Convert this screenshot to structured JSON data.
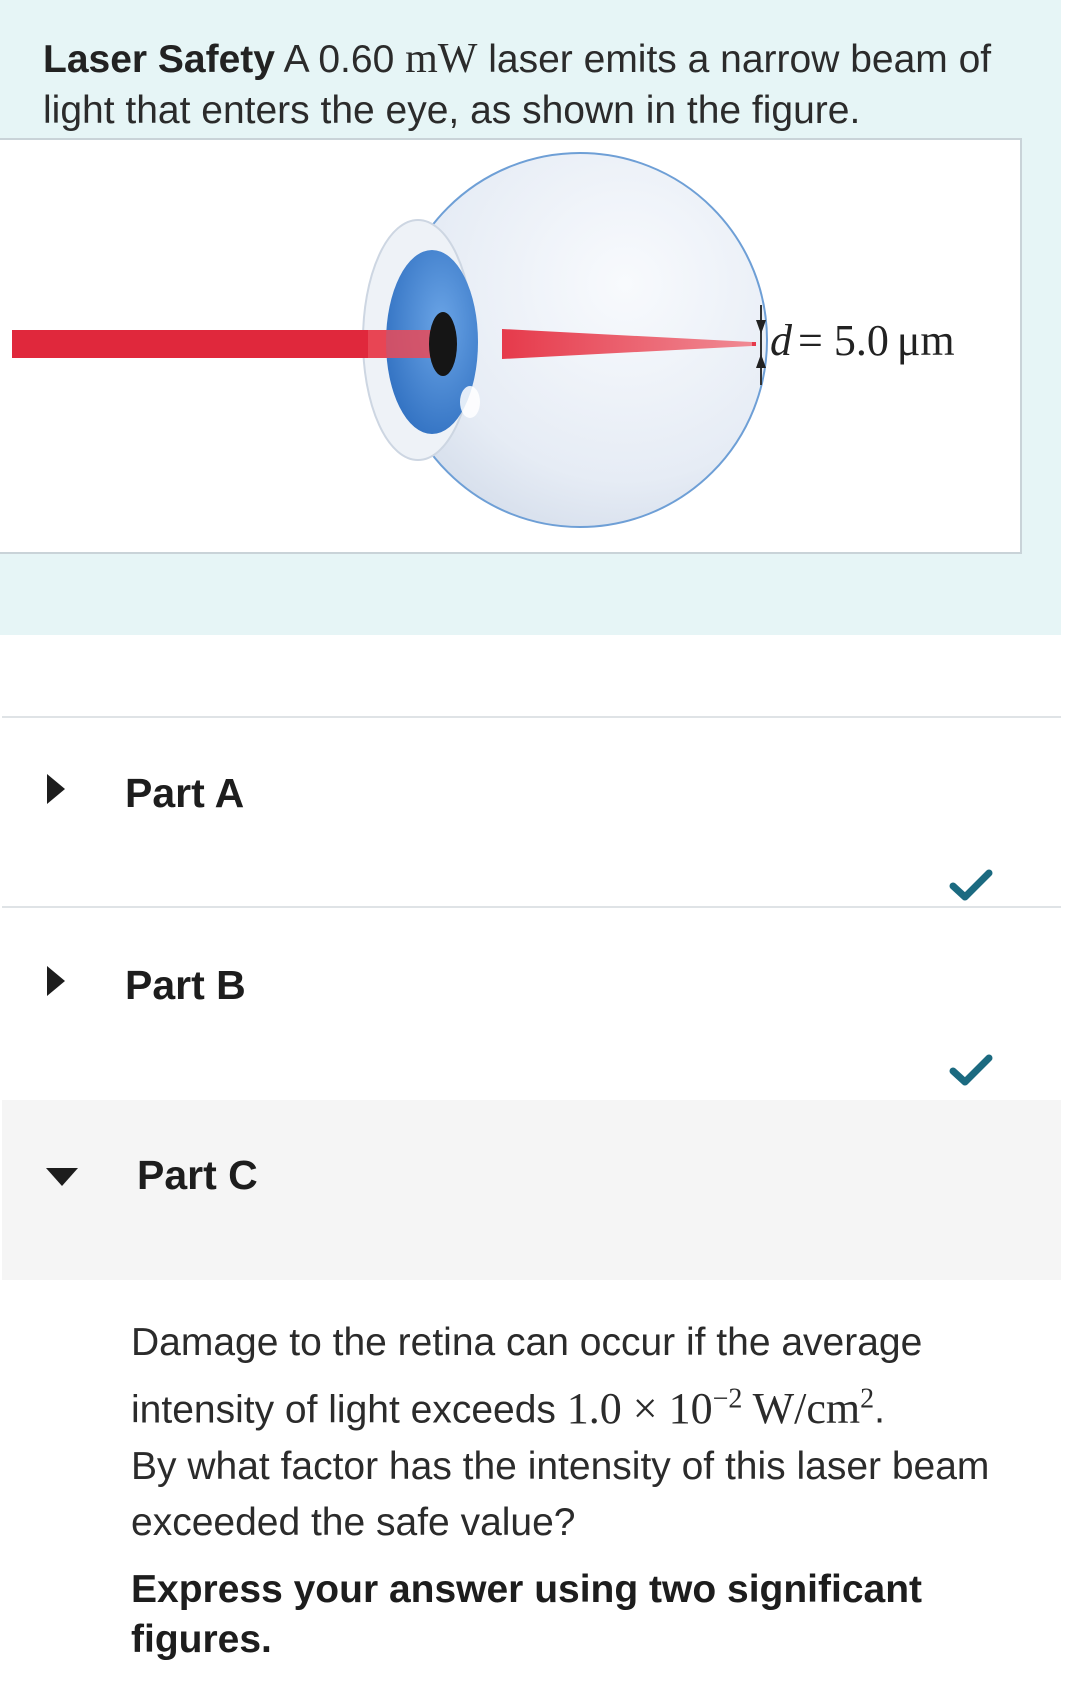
{
  "intro": {
    "title_bold": "Laser Safety",
    "text_before": "A 0.60",
    "unit": "mW",
    "text_after": "laser emits a narrow beam of light that enters the eye, as shown in the figure."
  },
  "figure": {
    "label_var": "d",
    "label_value": "= 5.0",
    "label_unit": "μm",
    "colors": {
      "beam": "#e0283c",
      "iris": "#3a7dd0",
      "eyeball": "#e9eef6"
    }
  },
  "parts": [
    {
      "label": "Part A",
      "state": "collapsed",
      "completed": true
    },
    {
      "label": "Part B",
      "state": "collapsed",
      "completed": true
    },
    {
      "label": "Part C",
      "state": "expanded",
      "completed": false
    }
  ],
  "question": {
    "line1": "Damage to the retina can occur if the average",
    "line2_prefix": "intensity of light exceeds",
    "value": "1.0 × 10",
    "exponent": "−2",
    "unit": "W/cm",
    "unit_exponent": "2",
    "period": ".",
    "line3": "By what factor has the intensity of this laser beam exceeded the safe value?"
  },
  "instruction": "Express your answer using two significant figures.",
  "colors": {
    "panel_bg": "#e6f5f6",
    "check": "#1b6a80",
    "expanded_bg": "#f5f5f5"
  }
}
